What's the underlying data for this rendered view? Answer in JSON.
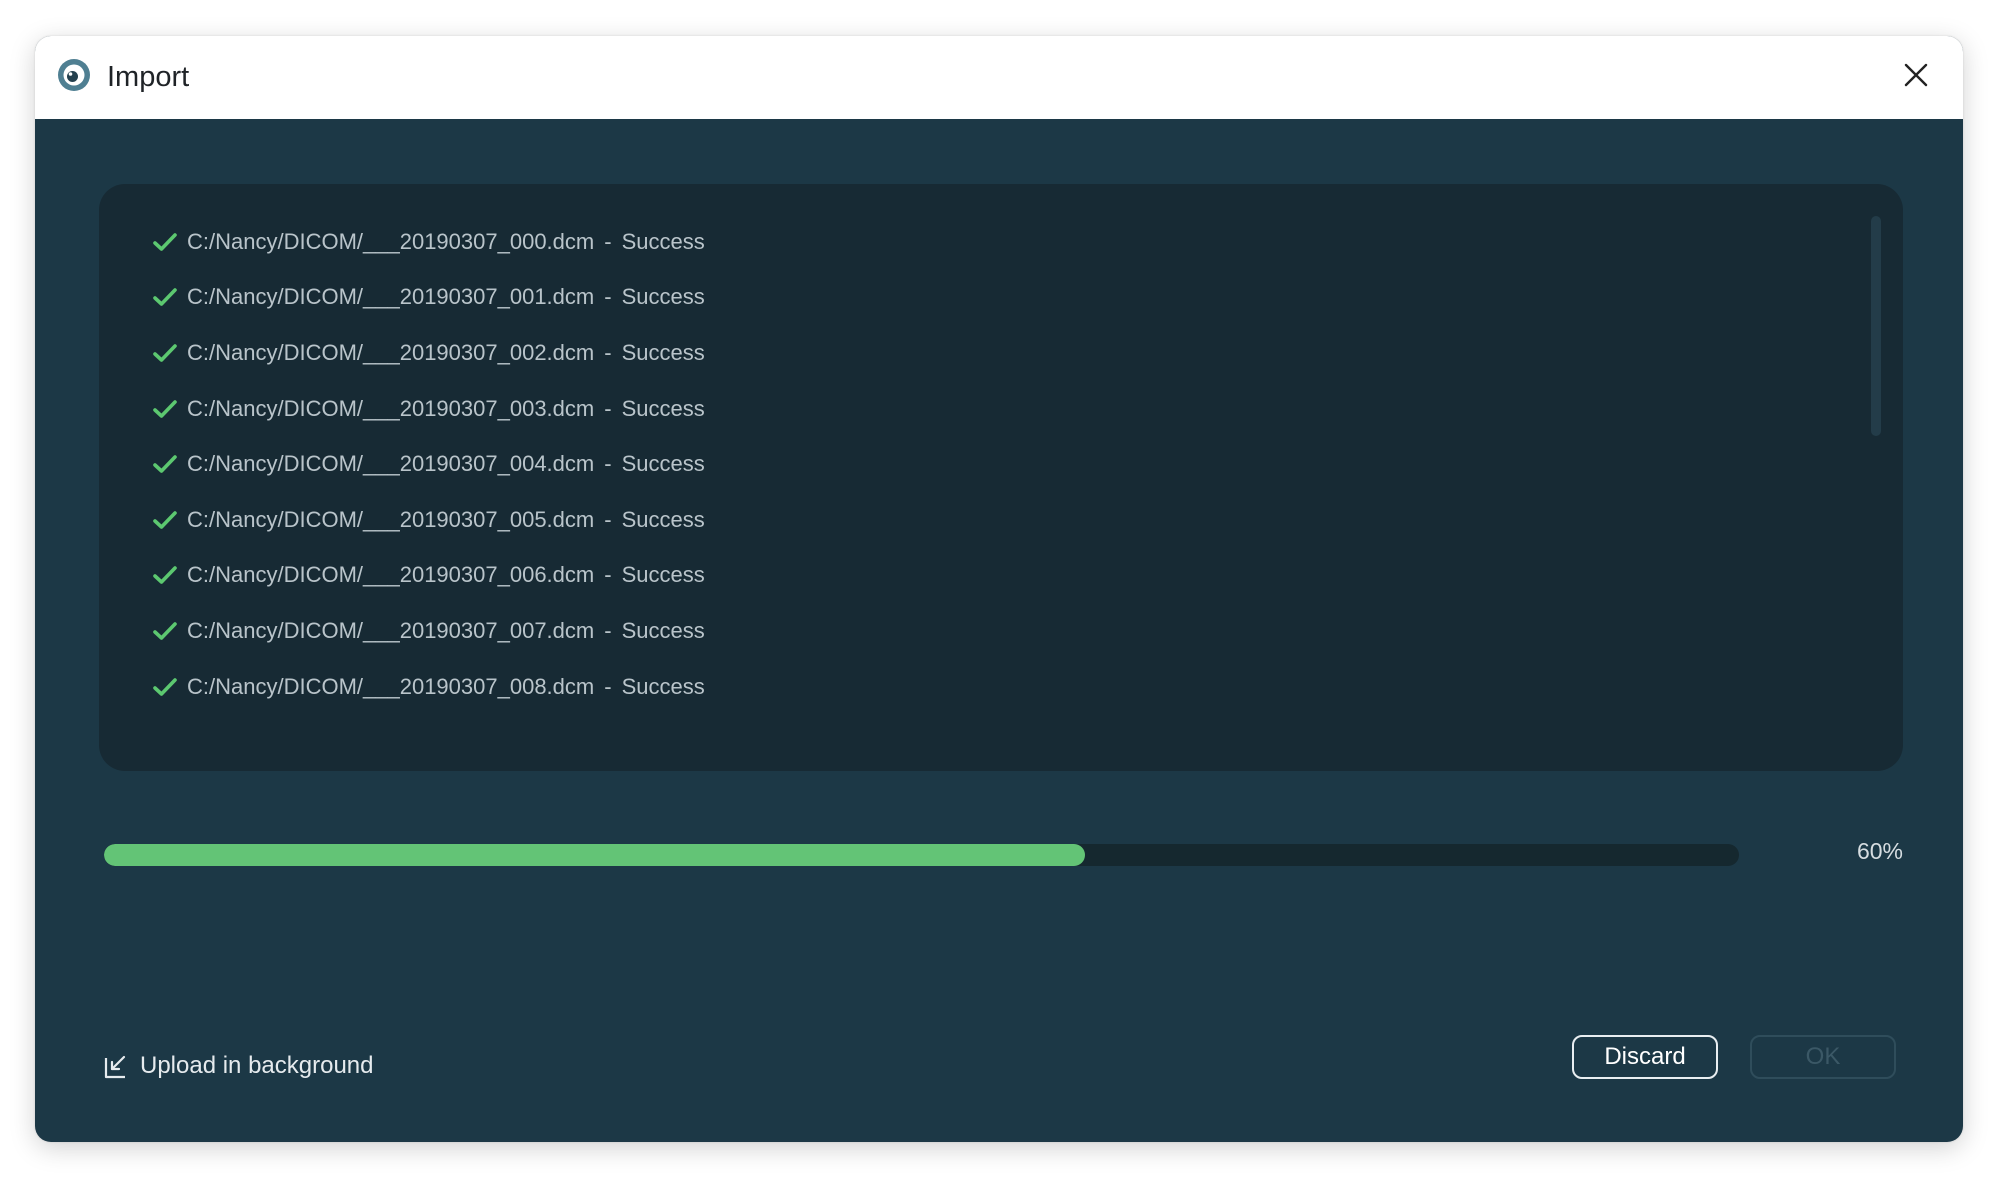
{
  "window": {
    "title": "Import",
    "icon": "app-logo-icon",
    "close_icon": "close-icon"
  },
  "log": {
    "items": [
      {
        "path": "C:/Nancy/DICOM/___20190307_000.dcm",
        "separator": "-",
        "status": "Success"
      },
      {
        "path": "C:/Nancy/DICOM/___20190307_001.dcm",
        "separator": "-",
        "status": "Success"
      },
      {
        "path": "C:/Nancy/DICOM/___20190307_002.dcm",
        "separator": "-",
        "status": "Success"
      },
      {
        "path": "C:/Nancy/DICOM/___20190307_003.dcm",
        "separator": "-",
        "status": "Success"
      },
      {
        "path": "C:/Nancy/DICOM/___20190307_004.dcm",
        "separator": "-",
        "status": "Success"
      },
      {
        "path": "C:/Nancy/DICOM/___20190307_005.dcm",
        "separator": "-",
        "status": "Success"
      },
      {
        "path": "C:/Nancy/DICOM/___20190307_006.dcm",
        "separator": "-",
        "status": "Success"
      },
      {
        "path": "C:/Nancy/DICOM/___20190307_007.dcm",
        "separator": "-",
        "status": "Success"
      },
      {
        "path": "C:/Nancy/DICOM/___20190307_008.dcm",
        "separator": "-",
        "status": "Success"
      }
    ],
    "status_icon": "checkmark-icon"
  },
  "progress": {
    "percent": 60,
    "label": "60%"
  },
  "footer": {
    "upload_background_label": "Upload in background",
    "upload_icon": "minimize-to-corner-icon",
    "discard_label": "Discard",
    "ok_label": "OK"
  },
  "colors": {
    "dialog_bg": "#1c3846",
    "panel_bg": "#172a34",
    "accent_green": "#63c476",
    "titlebar_bg": "#ffffff"
  }
}
